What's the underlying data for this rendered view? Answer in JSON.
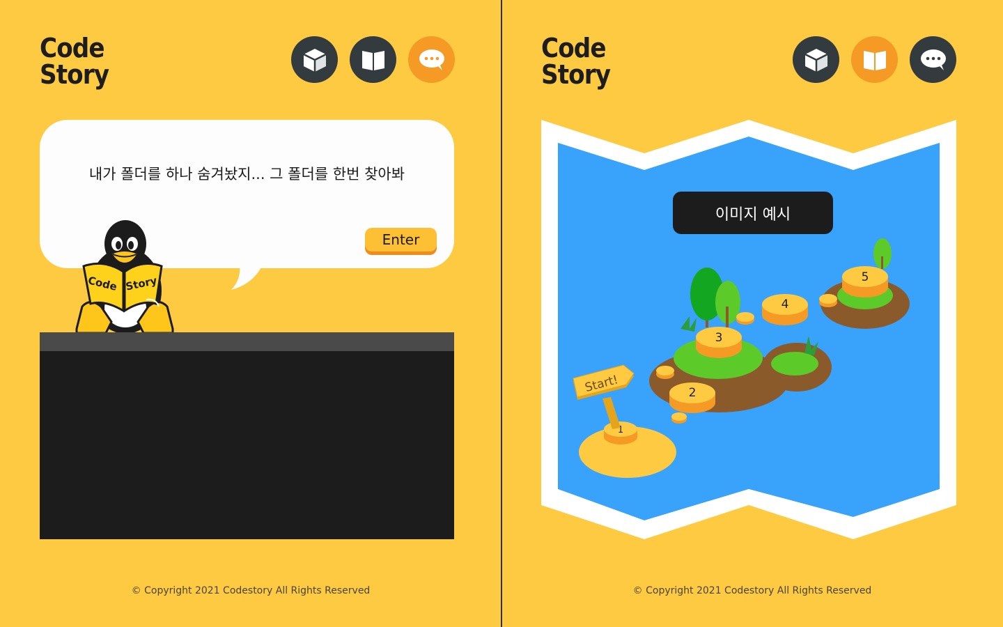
{
  "left": {
    "logo": {
      "line1": "Code",
      "line2": "Story"
    },
    "nav": [
      {
        "name": "cube",
        "icon": "cube-icon",
        "active": false
      },
      {
        "name": "book",
        "icon": "book-icon",
        "active": false
      },
      {
        "name": "chat",
        "icon": "chat-icon",
        "active": true
      }
    ],
    "dialog": {
      "message": "내가 폴더를 하나 숨겨놨지... 그 폴더를 한번 찾아봐",
      "enter_label": "Enter"
    },
    "mascot": {
      "book_left": "Code",
      "book_right": "Story"
    },
    "footer": "© Copyright 2021 Codestory All Rights Reserved"
  },
  "right": {
    "logo": {
      "line1": "Code",
      "line2": "Story"
    },
    "nav": [
      {
        "name": "cube",
        "icon": "cube-icon",
        "active": false
      },
      {
        "name": "book",
        "icon": "book-icon",
        "active": true
      },
      {
        "name": "chat",
        "icon": "chat-icon",
        "active": false
      }
    ],
    "map": {
      "example_label": "이미지 예시",
      "start_sign": "Start!",
      "stages": [
        "1",
        "2",
        "3",
        "4",
        "5"
      ]
    },
    "footer": "© Copyright 2021 Codestory All Rights Reserved"
  },
  "colors": {
    "background": "#FECA42",
    "nav_dark": "#333B3F",
    "nav_active": "#F59A25",
    "water": "#39A2FB",
    "terminal": "#1C1C1C"
  }
}
